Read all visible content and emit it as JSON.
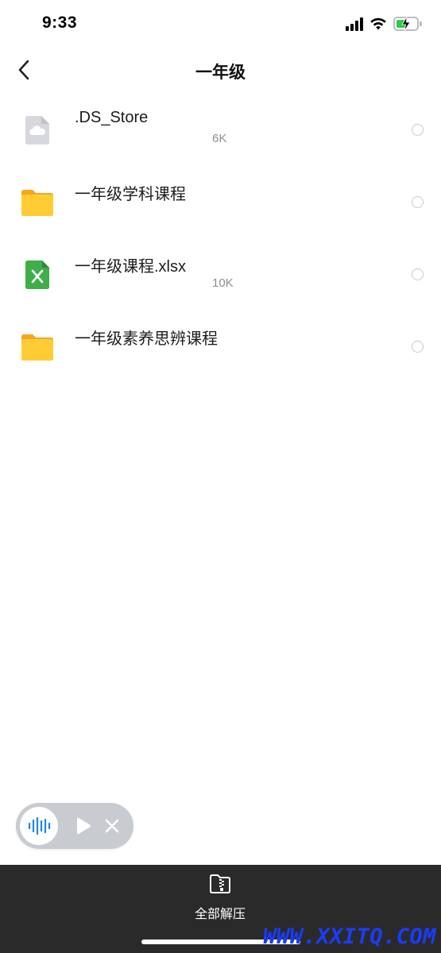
{
  "status_bar": {
    "time": "9:33",
    "icons": [
      "signal-icon",
      "wifi-icon",
      "battery-charging-icon"
    ],
    "battery_color": "#34c759"
  },
  "nav": {
    "title": "一年级",
    "back_icon": "chevron-left-icon"
  },
  "files": [
    {
      "name": ".DS_Store",
      "size": "6K",
      "icon": "cloud-file-icon"
    },
    {
      "name": "一年级学科课程",
      "size": "",
      "icon": "folder-icon"
    },
    {
      "name": "一年级课程.xlsx",
      "size": "10K",
      "icon": "excel-file-icon"
    },
    {
      "name": "一年级素养思辨课程",
      "size": "",
      "icon": "folder-icon"
    }
  ],
  "audio_player": {
    "icons": [
      "audio-wave-icon",
      "play-icon",
      "close-icon"
    ],
    "accent_color": "#1e88e5"
  },
  "bottom_bar": {
    "extract_all_label": "全部解压",
    "extract_icon": "zip-folder-icon",
    "background_color": "#2a2a2a"
  },
  "watermark": "WWW.XXITQ.COM"
}
